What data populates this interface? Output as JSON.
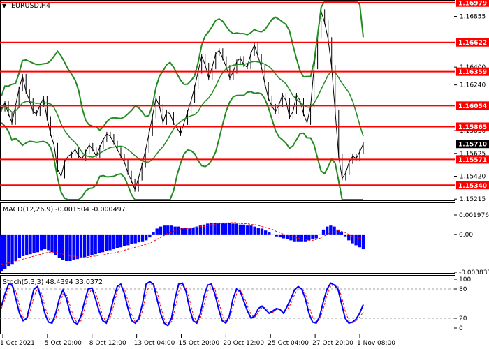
{
  "chart_data": {
    "type": "line",
    "symbol_title": "EURUSD,H4",
    "main_pane": {
      "y_axis_ticks": [
        "1.16979",
        "1.16855",
        "1.16622",
        "1.16400",
        "1.16359",
        "1.16240",
        "1.16054",
        "1.15830",
        "1.15865",
        "1.15710",
        "1.15625",
        "1.15571",
        "1.15420",
        "1.15340",
        "1.15215"
      ],
      "ylim": [
        1.5205,
        1.7005
      ],
      "support_resistance_levels": [
        {
          "value": 1.16979,
          "label": "1.16979"
        },
        {
          "value": 1.16622,
          "label": "1.16622"
        },
        {
          "value": 1.16359,
          "label": "1.16359"
        },
        {
          "value": 1.16054,
          "label": "1.16054"
        },
        {
          "value": 1.15865,
          "label": "1.15865"
        },
        {
          "value": 1.15571,
          "label": "1.15571"
        },
        {
          "value": 1.1534,
          "label": "1.15340"
        }
      ],
      "current_price": "1.15710",
      "level_color": "#ff0000",
      "current_price_color": "#000000",
      "price_series": {
        "name": "",
        "values": [
          1.1602,
          1.1608,
          1.1598,
          1.159,
          1.1605,
          1.162,
          1.1632,
          1.1618,
          1.161,
          1.16,
          1.1598,
          1.1606,
          1.1612,
          1.1594,
          1.158,
          1.157,
          1.1548,
          1.1542,
          1.1555,
          1.156,
          1.1562,
          1.1566,
          1.156,
          1.1558,
          1.1564,
          1.157,
          1.1566,
          1.156,
          1.1568,
          1.1575,
          1.158,
          1.1578,
          1.1572,
          1.1566,
          1.156,
          1.1555,
          1.1545,
          1.1538,
          1.153,
          1.154,
          1.1552,
          1.1565,
          1.158,
          1.1596,
          1.1612,
          1.1605,
          1.159,
          1.16,
          1.1598,
          1.159,
          1.1585,
          1.158,
          1.159,
          1.16,
          1.161,
          1.1622,
          1.1636,
          1.165,
          1.1642,
          1.163,
          1.164,
          1.1652,
          1.1655,
          1.1648,
          1.164,
          1.163,
          1.1636,
          1.1645,
          1.1648,
          1.1642,
          1.164,
          1.1652,
          1.166,
          1.165,
          1.164,
          1.1625,
          1.1612,
          1.1605,
          1.16,
          1.1606,
          1.1615,
          1.161,
          1.1595,
          1.16,
          1.1615,
          1.161,
          1.1598,
          1.159,
          1.1605,
          1.164,
          1.1668,
          1.169,
          1.168,
          1.1665,
          1.164,
          1.16,
          1.156,
          1.154,
          1.1545,
          1.1555,
          1.156,
          1.1558,
          1.1564,
          1.1571
        ]
      }
    },
    "macd_pane": {
      "title": "MACD(12,26,9) -0.001504 -0.000497",
      "y_axis_ticks": [
        "0.001976",
        "0.00",
        "-0.003833"
      ],
      "ylim": [
        -0.003833,
        0.001976
      ],
      "histogram": [
        -0.0037,
        -0.0035,
        -0.0032,
        -0.003,
        -0.0027,
        -0.0024,
        -0.0022,
        -0.0021,
        -0.002,
        -0.0019,
        -0.0018,
        -0.0016,
        -0.0015,
        -0.0016,
        -0.0018,
        -0.0021,
        -0.0024,
        -0.0026,
        -0.0027,
        -0.0027,
        -0.0026,
        -0.0025,
        -0.0024,
        -0.0023,
        -0.0022,
        -0.0021,
        -0.002,
        -0.0019,
        -0.0018,
        -0.0017,
        -0.0016,
        -0.0015,
        -0.0014,
        -0.0013,
        -0.0012,
        -0.0011,
        -0.001,
        -0.0009,
        -0.0008,
        -0.0007,
        -0.0006,
        -0.0003,
        0.0002,
        0.0006,
        0.0008,
        0.0009,
        0.0009,
        0.0009,
        0.0008,
        0.0008,
        0.0007,
        0.0007,
        0.0006,
        0.0007,
        0.0008,
        0.0009,
        0.001,
        0.0011,
        0.0012,
        0.0012,
        0.0012,
        0.0012,
        0.0012,
        0.0012,
        0.0011,
        0.0011,
        0.001,
        0.001,
        0.0009,
        0.0009,
        0.0008,
        0.0007,
        0.0006,
        0.0004,
        0.0002,
        0.0,
        -0.0002,
        -0.0003,
        -0.0004,
        -0.0005,
        -0.0006,
        -0.0007,
        -0.0007,
        -0.0007,
        -0.0007,
        -0.0006,
        -0.0005,
        -0.0004,
        0.0,
        0.0005,
        0.0008,
        0.0009,
        0.0008,
        0.0005,
        0.0002,
        -0.0002,
        -0.0006,
        -0.0009,
        -0.0011,
        -0.0013,
        -0.0015
      ],
      "signal": [
        -0.003,
        -0.003,
        -0.0029,
        -0.0028,
        -0.0027,
        -0.0026,
        -0.0025,
        -0.0024,
        -0.0023,
        -0.0022,
        -0.0021,
        -0.002,
        -0.0019,
        -0.0018,
        -0.0018,
        -0.0018,
        -0.0019,
        -0.002,
        -0.0021,
        -0.0022,
        -0.0022,
        -0.0023,
        -0.0023,
        -0.0023,
        -0.0023,
        -0.0022,
        -0.0022,
        -0.0021,
        -0.0021,
        -0.002,
        -0.0019,
        -0.0019,
        -0.0018,
        -0.0017,
        -0.0016,
        -0.0015,
        -0.0014,
        -0.0013,
        -0.0012,
        -0.0011,
        -0.001,
        -0.0009,
        -0.0007,
        -0.0005,
        -0.0003,
        -0.0001,
        0.0001,
        0.0002,
        0.0004,
        0.0005,
        0.0006,
        0.0006,
        0.0006,
        0.0007,
        0.0007,
        0.0008,
        0.0008,
        0.0009,
        0.001,
        0.001,
        0.0011,
        0.0011,
        0.0011,
        0.0012,
        0.0012,
        0.0012,
        0.0011,
        0.0011,
        0.0011,
        0.001,
        0.001,
        0.0009,
        0.0008,
        0.0007,
        0.0006,
        0.0005,
        0.0003,
        0.0002,
        0.0,
        -0.0001,
        -0.0002,
        -0.0003,
        -0.0004,
        -0.0005,
        -0.0005,
        -0.0006,
        -0.0006,
        -0.0005,
        -0.0004,
        -0.0002,
        0.0,
        0.0002,
        0.0003,
        0.0004,
        0.0003,
        0.0002,
        0.0,
        -0.0002,
        -0.0003,
        -0.0004,
        -0.0005
      ],
      "histogram_color": "#0000ff",
      "signal_color": "#ff0000"
    },
    "stoch_pane": {
      "title": "Stoch(5,3,3) 48.4394 33.0372",
      "y_axis_ticks": [
        "100",
        "80",
        "20",
        "0"
      ],
      "ylim": [
        0,
        100
      ],
      "levels": [
        80,
        20
      ],
      "main": [
        45,
        70,
        90,
        88,
        60,
        30,
        15,
        20,
        50,
        80,
        85,
        60,
        30,
        12,
        10,
        30,
        60,
        78,
        60,
        30,
        12,
        8,
        25,
        55,
        80,
        82,
        60,
        35,
        15,
        10,
        30,
        60,
        85,
        90,
        70,
        40,
        15,
        10,
        20,
        50,
        90,
        95,
        90,
        60,
        30,
        10,
        5,
        20,
        60,
        90,
        92,
        75,
        40,
        15,
        10,
        30,
        65,
        88,
        90,
        70,
        40,
        15,
        10,
        25,
        60,
        80,
        75,
        55,
        35,
        20,
        25,
        40,
        45,
        38,
        30,
        35,
        40,
        38,
        30,
        45,
        60,
        78,
        85,
        80,
        60,
        30,
        12,
        10,
        25,
        55,
        80,
        92,
        88,
        80,
        50,
        20,
        10,
        12,
        18,
        30,
        48
      ],
      "signal": [
        40,
        60,
        80,
        88,
        75,
        45,
        22,
        18,
        35,
        65,
        80,
        72,
        45,
        20,
        12,
        20,
        45,
        70,
        68,
        45,
        22,
        10,
        15,
        40,
        68,
        80,
        72,
        50,
        25,
        12,
        20,
        45,
        75,
        88,
        80,
        55,
        28,
        12,
        15,
        35,
        70,
        90,
        90,
        75,
        45,
        18,
        8,
        12,
        40,
        75,
        90,
        82,
        58,
        28,
        12,
        20,
        48,
        75,
        88,
        80,
        55,
        28,
        12,
        18,
        42,
        70,
        78,
        65,
        45,
        28,
        22,
        32,
        42,
        42,
        35,
        32,
        38,
        38,
        34,
        38,
        50,
        68,
        80,
        82,
        70,
        45,
        22,
        12,
        18,
        40,
        68,
        85,
        90,
        85,
        65,
        35,
        15,
        10,
        14,
        22,
        33
      ],
      "main_color": "#0000ff",
      "signal_color": "#ff0000"
    },
    "x_axis_ticks": [
      "1 Oct 2021",
      "5 Oct 20:00",
      "8 Oct 12:00",
      "13 Oct 04:00",
      "15 Oct 20:00",
      "20 Oct 12:00",
      "25 Oct 04:00",
      "27 Oct 20:00",
      "1 Nov 08:00"
    ],
    "grid": false
  }
}
